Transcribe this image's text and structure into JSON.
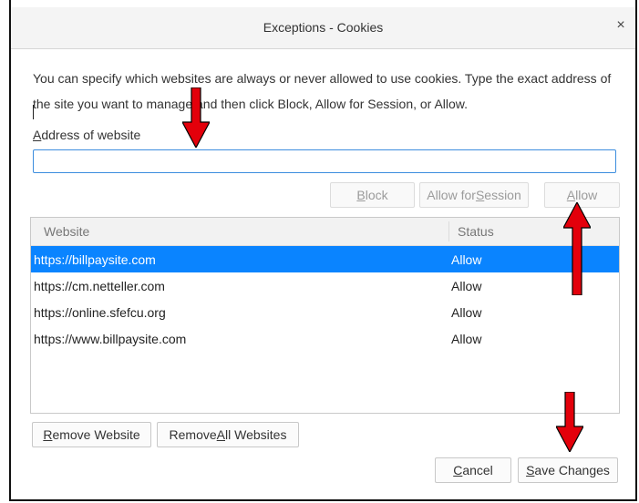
{
  "window": {
    "title": "Exceptions - Cookies",
    "close_glyph": "×"
  },
  "description": "You can specify which websites are always or never allowed to use cookies. Type the exact address of the site you want to manage and then click Block, Allow for Session, or Allow.",
  "address": {
    "label_access_key": "A",
    "label_rest": "ddress of website",
    "value": "",
    "placeholder": ""
  },
  "action_buttons": {
    "block_key": "B",
    "block_rest": "lock",
    "session_prefix": "Allow for ",
    "session_key": "S",
    "session_rest": "ession",
    "allow_key": "A",
    "allow_rest": "llow"
  },
  "table": {
    "columns": [
      "Website",
      "Status"
    ],
    "rows": [
      {
        "website": "https://billpaysite.com",
        "status": "Allow",
        "selected": true
      },
      {
        "website": "https://cm.netteller.com",
        "status": "Allow",
        "selected": false
      },
      {
        "website": "https://online.sfefcu.org",
        "status": "Allow",
        "selected": false
      },
      {
        "website": "https://www.billpaysite.com",
        "status": "Allow",
        "selected": false
      }
    ]
  },
  "bottom_buttons": {
    "remove_key": "R",
    "remove_rest": "emove Website",
    "remove_all_prefix": "Remove ",
    "remove_all_key": "A",
    "remove_all_rest": "ll Websites",
    "cancel_key": "C",
    "cancel_rest": "ancel",
    "save_key": "S",
    "save_rest": "ave Changes"
  },
  "colors": {
    "selection": "#0a84ff",
    "arrow": "#e3000b",
    "focus_border": "#3c8dde"
  },
  "annotations": [
    "red-arrow-down",
    "red-arrow-up",
    "red-arrow-down"
  ]
}
